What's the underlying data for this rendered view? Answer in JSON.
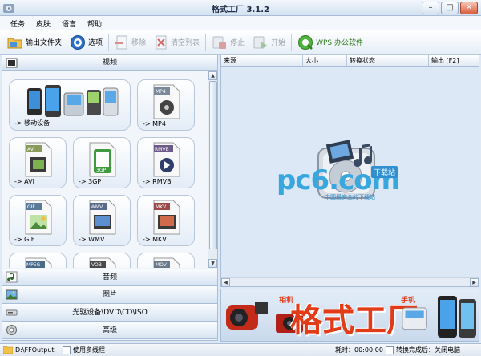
{
  "window": {
    "title": "格式工厂  3.1.2",
    "buttons": [
      "–",
      "□",
      "✕"
    ]
  },
  "menu": [
    "任务",
    "皮肤",
    "语言",
    "帮助"
  ],
  "toolbar": {
    "output_folder": "输出文件夹",
    "options": "选项",
    "remove": "移除",
    "clear_list": "清空列表",
    "stop": "停止",
    "start": "开始",
    "wps": "WPS 办公软件"
  },
  "categories": {
    "video": "视频",
    "audio": "音频",
    "picture": "图片",
    "optical": "光驱设备\\DVD\\CD\\ISO",
    "advanced": "高级"
  },
  "video_tiles": {
    "mobile": "-> 移动设备",
    "mp4": "-> MP4",
    "avi": "-> AVI",
    "threegp": "-> 3GP",
    "rmvb": "-> RMVB",
    "gif": "-> GIF",
    "wmv": "-> WMV",
    "mkv": "-> MKV"
  },
  "file_badges": {
    "mp4": "MP4",
    "avi": "AVI",
    "threegp": "3GP",
    "rmvb": "RMVB",
    "gif": "GIF",
    "wmv": "WMV",
    "mkv": "MKV",
    "mpeg": "MPEG",
    "vob": "VOB",
    "mov": "MOV"
  },
  "task_columns": [
    "来源",
    "大小",
    "转换状态",
    "输出 [F2]"
  ],
  "watermark": {
    "logo": "pc6.com",
    "tag": "下载站",
    "sub": "中国最安全的下载站"
  },
  "banner": {
    "title": "格式工厂",
    "small1": "相机",
    "small2": "手机"
  },
  "status": {
    "output_path": "D:\\FFOutput",
    "multithread": "使用多线程",
    "elapsed": "耗时：00:00:00",
    "after_convert": "转换完成后：关闭电脑"
  }
}
